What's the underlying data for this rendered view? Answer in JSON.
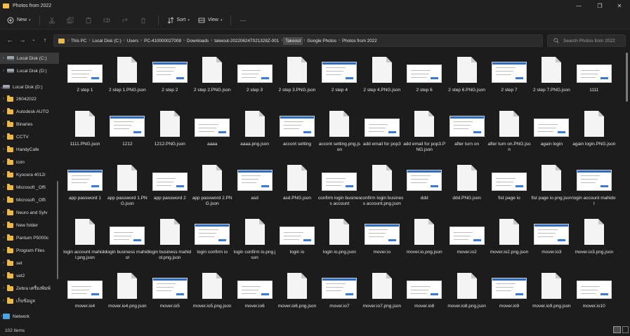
{
  "window": {
    "title": "Photos from 2022",
    "controls": [
      "minimize",
      "maximize",
      "close"
    ]
  },
  "commandbar": {
    "new_label": "New",
    "sort_label": "Sort",
    "view_label": "View",
    "more_label": "···"
  },
  "address": {
    "crumbs": [
      "This PC",
      "Local Disk (C:)",
      "Users",
      "PC-410000027008",
      "Downloads",
      "takeout-20220624T021328Z-001",
      "Takeout",
      "Google Photos",
      "Photos from 2022"
    ],
    "selected_crumb": "Takeout"
  },
  "search": {
    "placeholder": "Search Photos from 2022"
  },
  "sidebar": {
    "items": [
      {
        "label": "Local Disk (C:)",
        "icon": "drive-icon",
        "selected": true
      },
      {
        "label": "Local Disk (D:)",
        "icon": "drive-icon",
        "selected": false
      },
      {
        "label": "Local Disk (D:)",
        "icon": "drive-icon",
        "selected": false
      },
      {
        "label": "26042022",
        "icon": "folder-icon",
        "selected": false
      },
      {
        "label": "Autodesk AUTO",
        "icon": "folder-icon",
        "selected": false
      },
      {
        "label": "Binaries",
        "icon": "folder-icon",
        "selected": false
      },
      {
        "label": "CCTV",
        "icon": "folder-icon",
        "selected": false
      },
      {
        "label": "HandyCafe",
        "icon": "folder-icon",
        "selected": false
      },
      {
        "label": "icon",
        "icon": "folder-icon",
        "selected": false
      },
      {
        "label": "Kyocera 4012i",
        "icon": "folder-icon",
        "selected": false
      },
      {
        "label": "Microsoft _Offi",
        "icon": "folder-icon",
        "selected": false
      },
      {
        "label": "Microsoft _Offi",
        "icon": "folder-icon",
        "selected": false
      },
      {
        "label": "Neuro and Sylv",
        "icon": "folder-icon",
        "selected": false
      },
      {
        "label": "New folder",
        "icon": "folder-icon",
        "selected": false
      },
      {
        "label": "Pantum P5000c",
        "icon": "folder-icon",
        "selected": false
      },
      {
        "label": "Program Files",
        "icon": "folder-icon",
        "selected": false
      },
      {
        "label": "set",
        "icon": "folder-icon",
        "selected": false
      },
      {
        "label": "set2",
        "icon": "folder-icon",
        "selected": false
      },
      {
        "label": "Zebra เครื่องพิมพ์",
        "icon": "folder-icon",
        "selected": false
      },
      {
        "label": "เก็บข้อมูล",
        "icon": "folder-icon",
        "selected": false
      },
      {
        "label": "Network",
        "icon": "network-icon",
        "selected": false
      }
    ]
  },
  "files": [
    {
      "name": "2 step 1",
      "kind": "image"
    },
    {
      "name": "2 step 1.PNG.json",
      "kind": "doc"
    },
    {
      "name": "2 step 2",
      "kind": "image"
    },
    {
      "name": "2 step 2.PNG.json",
      "kind": "doc"
    },
    {
      "name": "2 step 3",
      "kind": "image"
    },
    {
      "name": "2 step 3.PNG.json",
      "kind": "doc"
    },
    {
      "name": "2 step 4",
      "kind": "image"
    },
    {
      "name": "2 step 4.PNG.json",
      "kind": "doc"
    },
    {
      "name": "2 step 6",
      "kind": "image"
    },
    {
      "name": "2 step 6.PNG.json",
      "kind": "doc"
    },
    {
      "name": "2 step 7",
      "kind": "image"
    },
    {
      "name": "2 step 7.PNG.json",
      "kind": "doc"
    },
    {
      "name": "1111",
      "kind": "image"
    },
    {
      "name": "1111.PNG.json",
      "kind": "doc"
    },
    {
      "name": "1212",
      "kind": "image"
    },
    {
      "name": "1212.PNG.json",
      "kind": "doc"
    },
    {
      "name": "aaaa",
      "kind": "image"
    },
    {
      "name": "aaaa.png.json",
      "kind": "doc"
    },
    {
      "name": "accont setting",
      "kind": "image"
    },
    {
      "name": "accont setting.png.json",
      "kind": "doc"
    },
    {
      "name": "add email for pop3",
      "kind": "image"
    },
    {
      "name": "add email for pop3.PNG.json",
      "kind": "doc"
    },
    {
      "name": "after turn on",
      "kind": "image"
    },
    {
      "name": "after turn on.PNG.json",
      "kind": "doc"
    },
    {
      "name": "again login",
      "kind": "image"
    },
    {
      "name": "again login.PNG.json",
      "kind": "doc"
    },
    {
      "name": "app password 1",
      "kind": "image"
    },
    {
      "name": "app password 1.PNG.json",
      "kind": "doc"
    },
    {
      "name": "app password 2",
      "kind": "image"
    },
    {
      "name": "app password 2.PNG.json",
      "kind": "doc"
    },
    {
      "name": "asd",
      "kind": "image"
    },
    {
      "name": "asd.PNG.json",
      "kind": "doc"
    },
    {
      "name": "confirm login business account",
      "kind": "image"
    },
    {
      "name": "confirm login business account.png.json",
      "kind": "doc"
    },
    {
      "name": "ddd",
      "kind": "image"
    },
    {
      "name": "ddd.PNG.json",
      "kind": "doc"
    },
    {
      "name": "fist page io",
      "kind": "image"
    },
    {
      "name": "fist page io.png.json",
      "kind": "doc"
    },
    {
      "name": "login account mahidol",
      "kind": "image"
    },
    {
      "name": "login account mahidol.png.json",
      "kind": "doc"
    },
    {
      "name": "login business mahidol",
      "kind": "image"
    },
    {
      "name": "login business mahidol.png.json",
      "kind": "doc"
    },
    {
      "name": "login confirm io",
      "kind": "image"
    },
    {
      "name": "login confirm io.png.json",
      "kind": "doc"
    },
    {
      "name": "login io",
      "kind": "image"
    },
    {
      "name": "login io.png.json",
      "kind": "doc"
    },
    {
      "name": "mover.io",
      "kind": "image"
    },
    {
      "name": "mover.io.png.json",
      "kind": "doc"
    },
    {
      "name": "mover.io2",
      "kind": "image"
    },
    {
      "name": "mover.io2.png.json",
      "kind": "doc"
    },
    {
      "name": "mover.io3",
      "kind": "image"
    },
    {
      "name": "mover.io3.png.json",
      "kind": "doc"
    },
    {
      "name": "mover.io4",
      "kind": "image"
    },
    {
      "name": "mover.io4.png.json",
      "kind": "doc"
    },
    {
      "name": "mover.io5",
      "kind": "image"
    },
    {
      "name": "mover.io5.png.json",
      "kind": "doc"
    },
    {
      "name": "mover.io6",
      "kind": "image"
    },
    {
      "name": "mover.io6.png.json",
      "kind": "doc"
    },
    {
      "name": "mover.io7",
      "kind": "image"
    },
    {
      "name": "mover.io7.png.json",
      "kind": "doc"
    },
    {
      "name": "mover.io8",
      "kind": "image"
    },
    {
      "name": "mover.io8.png.json",
      "kind": "doc"
    },
    {
      "name": "mover.io9",
      "kind": "image"
    },
    {
      "name": "mover.io9.png.json",
      "kind": "doc"
    },
    {
      "name": "mover.io10",
      "kind": "image"
    }
  ],
  "status": {
    "item_count": "102 items"
  },
  "colors": {
    "background": "#1c1c1c",
    "folder": "#e9b949",
    "accent": "#2f6ec0"
  }
}
